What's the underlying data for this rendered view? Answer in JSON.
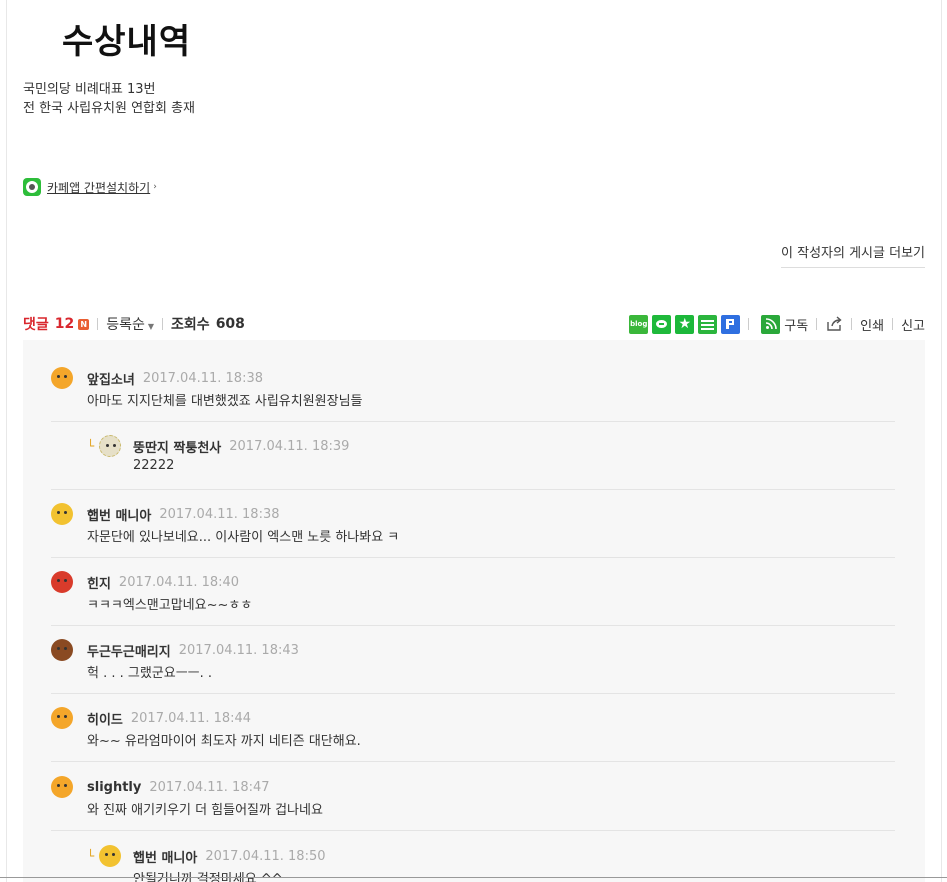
{
  "award": {
    "title": "수상내역"
  },
  "bio": {
    "line1": "국민의당 비례대표 13번",
    "line2": "전 한국 사립유치원 연합회 총재"
  },
  "cafe_app": {
    "label": "카페앱 간편설치하기"
  },
  "more_posts": {
    "label": "이 작성자의 게시글 더보기"
  },
  "toolbar": {
    "comments_label": "댓글",
    "comments_count": "12",
    "new_badge": "N",
    "sort_label": "등록순",
    "views_label": "조회수",
    "views_count": "608",
    "blog_icon_text": "blog",
    "subscribe_label": "구독",
    "print_label": "인쇄",
    "report_label": "신고"
  },
  "colors": {
    "accent_red": "#d9272e",
    "share_green": "#2bb53d",
    "comment_bg": "#f7f7f7"
  },
  "comments": [
    {
      "nick": "앞집소녀",
      "date": "2017.04.11. 18:38",
      "text": "아마도 지지단체를 대변했겠죠 사립유치원원장님들",
      "avatar": "orange-girl-icon",
      "reply": false
    },
    {
      "nick": "뚱딴지 짝퉁천사",
      "date": "2017.04.11. 18:39",
      "text": "22222",
      "avatar": "angel-icon",
      "reply": true
    },
    {
      "nick": "햅번 매니아",
      "date": "2017.04.11. 18:38",
      "text": "자문단에 있나보네요... 이사람이 엑스맨 노릇 하나봐요 ㅋ",
      "avatar": "sun-icon",
      "reply": false
    },
    {
      "nick": "힌지",
      "date": "2017.04.11. 18:40",
      "text": "ㅋㅋㅋ엑스맨고맙네요~~ㅎㅎ",
      "avatar": "red-girl-icon",
      "reply": false
    },
    {
      "nick": "두근두근매리지",
      "date": "2017.04.11. 18:43",
      "text": "헉 . . . 그랬군요ㅡㅡ. .",
      "avatar": "brown-girl-icon",
      "reply": false
    },
    {
      "nick": "히이드",
      "date": "2017.04.11. 18:44",
      "text": "와~~ 유라엄마이어 최도자 까지 네티즌 대단해요.",
      "avatar": "orange-girl-icon",
      "reply": false
    },
    {
      "nick": "slightly",
      "date": "2017.04.11. 18:47",
      "text": "와 진짜 애기키우기 더 힘들어질까 겁나네요",
      "avatar": "orange-girl-icon",
      "reply": false
    },
    {
      "nick": "햅번 매니아",
      "date": "2017.04.11. 18:50",
      "text": "안될거니까 걱정마세요 ^^",
      "avatar": "sun-icon",
      "reply": true
    }
  ]
}
